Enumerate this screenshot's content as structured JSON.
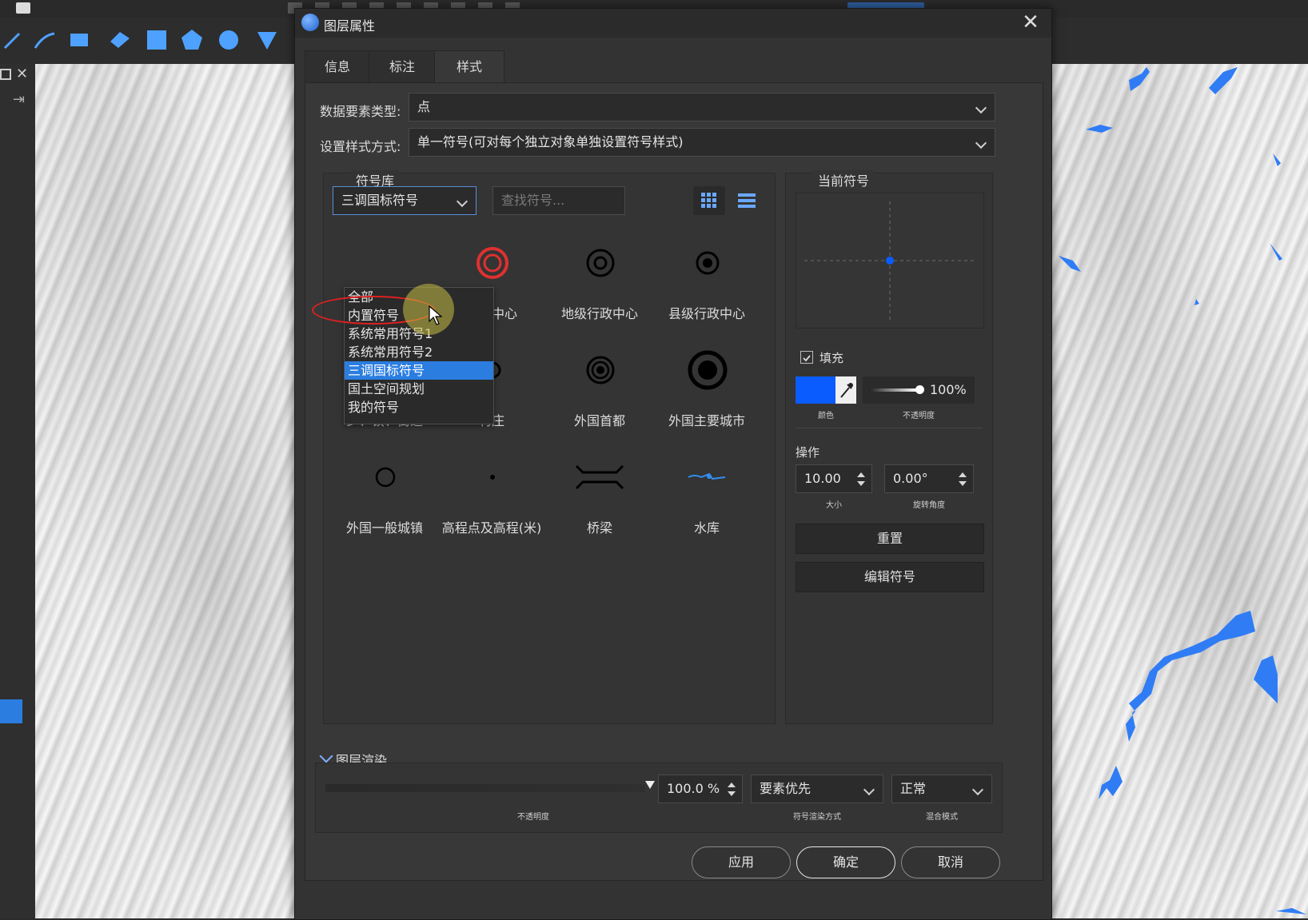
{
  "dialog": {
    "title": "图层属性",
    "close_glyph": "✕",
    "tabs": [
      {
        "label": "信息"
      },
      {
        "label": "标注"
      },
      {
        "label": "样式"
      }
    ]
  },
  "style": {
    "feature_type_label": "数据要素类型:",
    "feature_type_value": "点",
    "style_mode_label": "设置样式方式:",
    "style_mode_value": "单一符号(可对每个独立对象单独设置符号样式)"
  },
  "library": {
    "group_title": "符号库",
    "selected": "三调国标符号",
    "search_placeholder": "查找符号...",
    "options": [
      {
        "label": "全部"
      },
      {
        "label": "内置符号"
      },
      {
        "label": "系统常用符号1"
      },
      {
        "label": "系统常用符号2"
      },
      {
        "label": "三调国标符号"
      },
      {
        "label": "国土空间规划"
      },
      {
        "label": "我的符号"
      }
    ],
    "symbols": [
      {
        "label": "行政中心"
      },
      {
        "label": "地级行政中心"
      },
      {
        "label": "县级行政中心"
      },
      {
        "label": "乡、镇、街道"
      },
      {
        "label": "村庄"
      },
      {
        "label": "外国首都"
      },
      {
        "label": "外国主要城市"
      },
      {
        "label": "外国一般城镇"
      },
      {
        "label": "高程点及高程(米)"
      },
      {
        "label": "桥梁"
      },
      {
        "label": "水库"
      }
    ]
  },
  "current": {
    "group_title": "当前符号",
    "fill_label": "填充",
    "fill_color": "#0a5cff",
    "opacity_value": "100%",
    "color_caption": "颜色",
    "opacity_caption": "不透明度",
    "ops_label": "操作",
    "size_value": "10.00",
    "size_caption": "大小",
    "rotation_value": "0.00°",
    "rotation_caption": "旋转角度",
    "reset_label": "重置",
    "edit_label": "编辑符号"
  },
  "render": {
    "section_title": "图层渲染",
    "opacity_value": "100.0 %",
    "opacity_caption": "不透明度",
    "render_mode_value": "要素优先",
    "render_mode_caption": "符号渲染方式",
    "blend_value": "正常",
    "blend_caption": "混合模式"
  },
  "footer": {
    "apply_label": "应用",
    "ok_label": "确定",
    "cancel_label": "取消"
  },
  "colors": {
    "accent": "#2b7de0",
    "annotation_circle": "#e02020",
    "water": "#2f7cf5"
  }
}
